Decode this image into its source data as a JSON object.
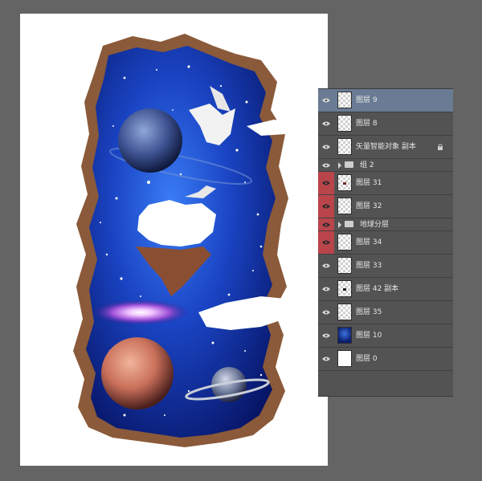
{
  "layers_panel": {
    "rows": [
      {
        "name": "图层 9",
        "type": "layer",
        "selected": true,
        "highlight": false,
        "thumb": "transparent"
      },
      {
        "name": "图层 8",
        "type": "layer",
        "selected": false,
        "highlight": false,
        "thumb": "transparent"
      },
      {
        "name": "矢量智能对象 副本",
        "type": "smart",
        "selected": false,
        "highlight": false,
        "thumb": "transparent",
        "locked": true
      },
      {
        "name": "组 2",
        "type": "group",
        "selected": false,
        "highlight": false
      },
      {
        "name": "图层 31",
        "type": "layer",
        "selected": false,
        "highlight": true,
        "thumb": "transparent-dot"
      },
      {
        "name": "图层 32",
        "type": "layer",
        "selected": false,
        "highlight": true,
        "thumb": "transparent"
      },
      {
        "name": "地球分层",
        "type": "group",
        "selected": false,
        "highlight": true
      },
      {
        "name": "图层 34",
        "type": "layer",
        "selected": false,
        "highlight": true,
        "thumb": "transparent"
      },
      {
        "name": "图层 33",
        "type": "layer",
        "selected": false,
        "highlight": false,
        "thumb": "transparent"
      },
      {
        "name": "图层 42 副本",
        "type": "layer",
        "selected": false,
        "highlight": false,
        "thumb": "transparent-dot"
      },
      {
        "name": "图层 35",
        "type": "layer",
        "selected": false,
        "highlight": false,
        "thumb": "transparent"
      },
      {
        "name": "图层 10",
        "type": "layer",
        "selected": false,
        "highlight": false,
        "thumb": "blue"
      },
      {
        "name": "图层 0",
        "type": "layer",
        "selected": false,
        "highlight": false,
        "thumb": "white"
      }
    ]
  },
  "colors": {
    "workspace": "#646464",
    "panel": "#535353",
    "selected": "#6a7b94",
    "visibility_highlight": "#b9454b",
    "space_deep": "#0a1f7a",
    "space_bright": "#2f6ef0"
  },
  "icons": {
    "visibility": "eye-icon",
    "lock": "lock-icon",
    "group": "folder-icon",
    "expand": "chevron-right-icon"
  }
}
